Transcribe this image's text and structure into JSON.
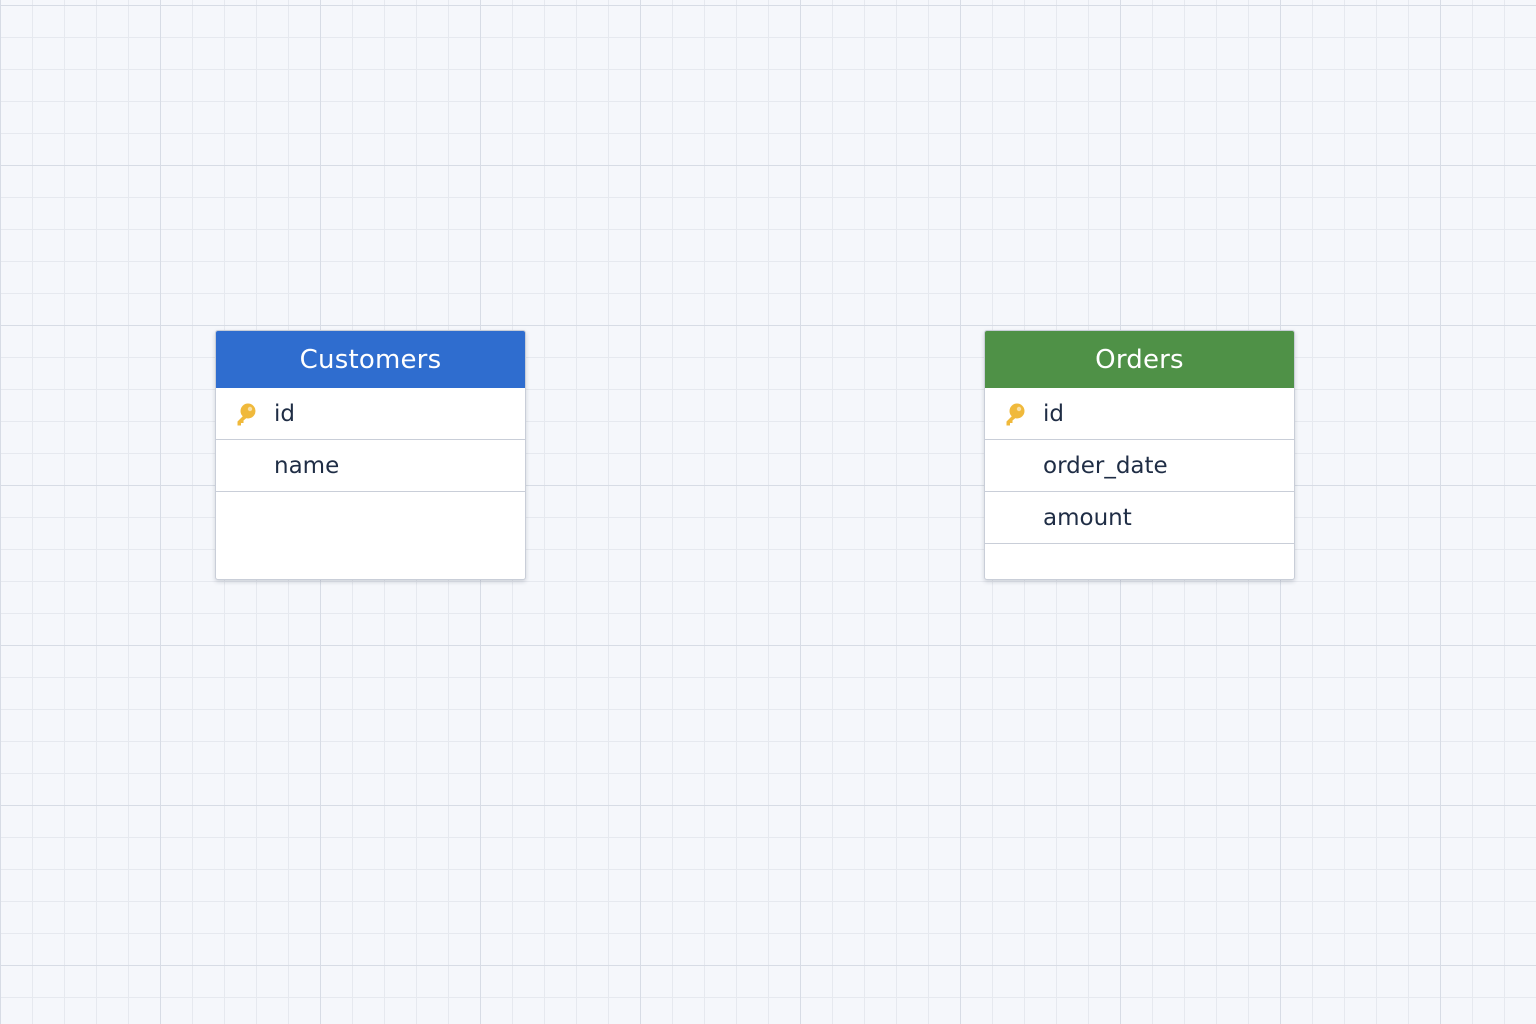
{
  "diagram": {
    "entities": [
      {
        "title": "Customers",
        "header_color": "#2f6dcf",
        "fields": [
          {
            "name": "id",
            "primary_key": true,
            "icon": "key-icon"
          },
          {
            "name": "name",
            "primary_key": false
          }
        ]
      },
      {
        "title": "Orders",
        "header_color": "#4f9147",
        "fields": [
          {
            "name": "id",
            "primary_key": true,
            "icon": "key-icon"
          },
          {
            "name": "order_date",
            "primary_key": false
          },
          {
            "name": "amount",
            "primary_key": false
          }
        ]
      }
    ],
    "key_icon_color": "#f0b93b"
  }
}
